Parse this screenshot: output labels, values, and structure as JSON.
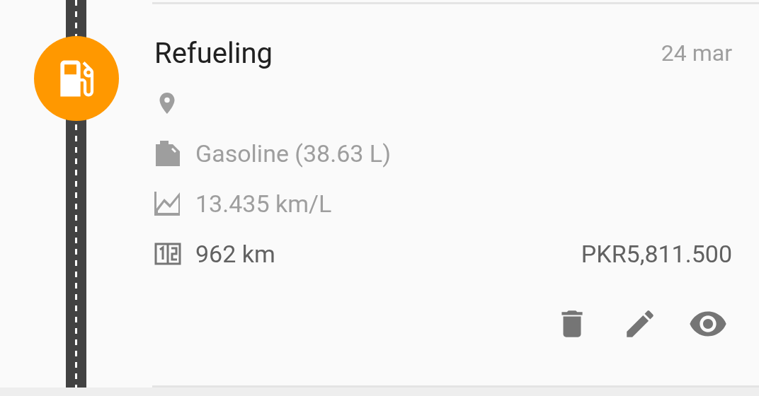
{
  "entry": {
    "title": "Refueling",
    "date": "24 mar",
    "kind": "refuel",
    "color": "#ff9800",
    "details": [
      {
        "kind": "location"
      },
      {
        "kind": "fuel",
        "text": "Gasoline (38.63 L)"
      },
      {
        "kind": "efficiency",
        "text": "13.435 km/L"
      },
      {
        "kind": "odometer",
        "text": "962 km"
      }
    ],
    "cost": "PKR5,811.500",
    "actions": [
      {
        "kind": "delete"
      },
      {
        "kind": "edit"
      },
      {
        "kind": "view"
      }
    ]
  }
}
